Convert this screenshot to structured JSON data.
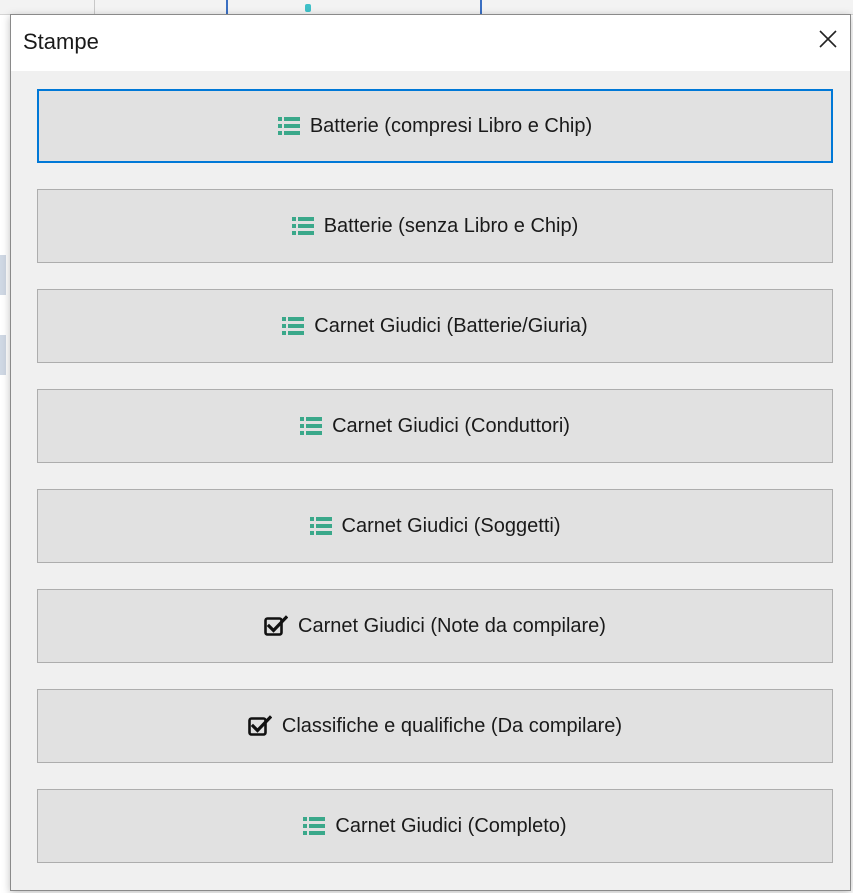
{
  "dialog": {
    "title": "Stampe",
    "close_icon": "close-icon"
  },
  "buttons": [
    {
      "label": "Batterie (compresi Libro e Chip)",
      "icon": "list-icon",
      "focused": true
    },
    {
      "label": "Batterie (senza Libro e Chip)",
      "icon": "list-icon",
      "focused": false
    },
    {
      "label": "Carnet Giudici (Batterie/Giuria)",
      "icon": "list-icon",
      "focused": false
    },
    {
      "label": "Carnet Giudici (Conduttori)",
      "icon": "list-icon",
      "focused": false
    },
    {
      "label": "Carnet Giudici (Soggetti)",
      "icon": "list-icon",
      "focused": false
    },
    {
      "label": "Carnet Giudici (Note da compilare)",
      "icon": "checkbox-icon",
      "focused": false
    },
    {
      "label": "Classifiche e qualifiche (Da compilare)",
      "icon": "checkbox-icon",
      "focused": false
    },
    {
      "label": "Carnet Giudici (Completo)",
      "icon": "list-icon",
      "focused": false
    }
  ],
  "colors": {
    "list_icon": "#3aa88a",
    "focus_border": "#0078d7",
    "button_bg": "#e1e1e1"
  }
}
